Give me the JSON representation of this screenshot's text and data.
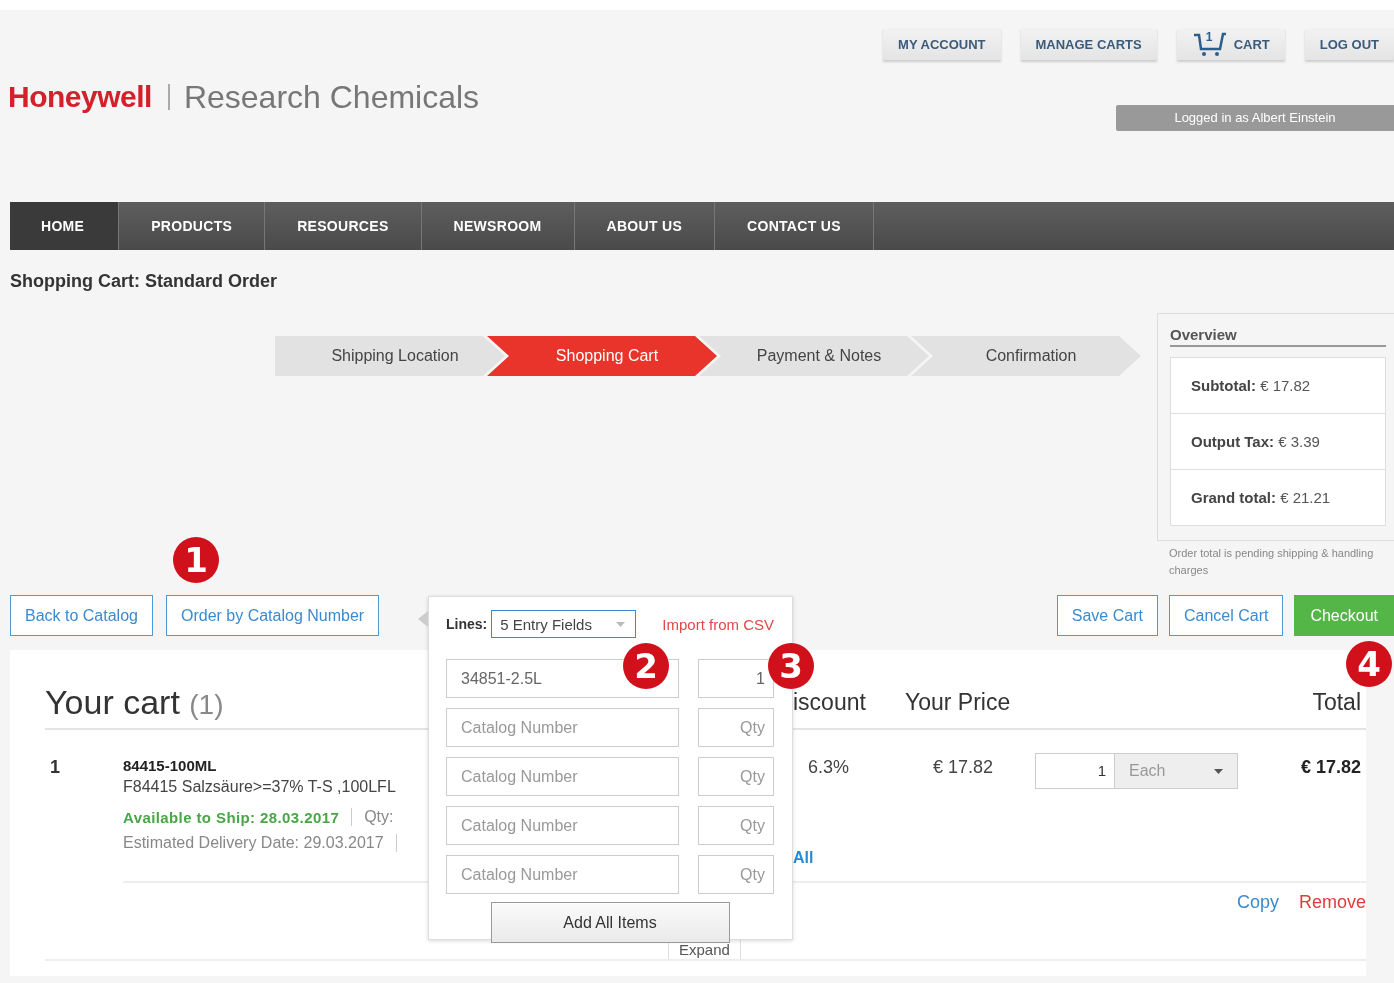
{
  "header": {
    "logo": {
      "brand": "Honeywell",
      "product": "Research Chemicals"
    },
    "top_buttons": [
      {
        "label": "MY ACCOUNT",
        "kind": "text"
      },
      {
        "label": "MANAGE CARTS",
        "kind": "text"
      },
      {
        "label": "CART",
        "kind": "cart",
        "count": "1"
      },
      {
        "label": "LOG OUT",
        "kind": "text"
      }
    ],
    "login_status": "Logged in as Albert Einstein"
  },
  "nav": [
    {
      "label": "HOME",
      "selected": true
    },
    {
      "label": "PRODUCTS",
      "selected": false
    },
    {
      "label": "RESOURCES",
      "selected": false
    },
    {
      "label": "NEWSROOM",
      "selected": false
    },
    {
      "label": "ABOUT US",
      "selected": false
    },
    {
      "label": "CONTACT US",
      "selected": false
    }
  ],
  "page_title": "Shopping Cart: Standard Order",
  "steps": [
    {
      "label": "Shipping Location",
      "selected": false
    },
    {
      "label": "Shopping Cart",
      "selected": true
    },
    {
      "label": "Payment & Notes",
      "selected": false
    },
    {
      "label": "Confirmation",
      "selected": false
    }
  ],
  "overview": {
    "title": "Overview",
    "rows": [
      {
        "label": "Subtotal:",
        "value": "€ 17.82"
      },
      {
        "label": "Output Tax:",
        "value": "€ 3.39"
      },
      {
        "label": "Grand total:",
        "value": "€ 21.21"
      }
    ],
    "note": "Order total is pending shipping & handling charges"
  },
  "actions_left": [
    {
      "label": "Back to Catalog",
      "kind": "outline"
    },
    {
      "label": "Order by Catalog Number",
      "kind": "outline"
    }
  ],
  "actions_right": [
    {
      "label": "Save Cart",
      "kind": "outline"
    },
    {
      "label": "Cancel Cart",
      "kind": "outline"
    },
    {
      "label": "Checkout",
      "kind": "primary"
    }
  ],
  "quick_order": {
    "lines_label": "Lines:",
    "lines_value": "5 Entry Fields",
    "import_link": "Import from CSV",
    "entries": [
      {
        "catalog": {
          "value": "34851-2.5L"
        },
        "qty": {
          "value": "1"
        }
      },
      {
        "catalog": {
          "placeholder": "Catalog Number"
        },
        "qty": {
          "placeholder": "Qty"
        }
      },
      {
        "catalog": {
          "placeholder": "Catalog Number"
        },
        "qty": {
          "placeholder": "Qty"
        }
      },
      {
        "catalog": {
          "placeholder": "Catalog Number"
        },
        "qty": {
          "placeholder": "Qty"
        }
      },
      {
        "catalog": {
          "placeholder": "Catalog Number"
        },
        "qty": {
          "placeholder": "Qty"
        }
      }
    ],
    "submit": "Add All Items"
  },
  "cart": {
    "title": "Your cart",
    "count": "(1)",
    "columns": [
      "iscount",
      "Your Price",
      "Total"
    ],
    "items": [
      {
        "index": "1",
        "code": "84415-100ML",
        "description": "F84415 Salzsäure>=37% T-S ,100LFL",
        "availability": "Available to Ship: 28.03.2017",
        "qty_label": "Qty:",
        "delivery": "Estimated Delivery Date: 29.03.2017",
        "discount": "6.3%",
        "link": "All",
        "price": "€ 17.82",
        "quantity": "1",
        "unit": "Each",
        "total": "€ 17.82",
        "actions": [
          {
            "label": "Copy",
            "kind": "default"
          },
          {
            "label": "Remove",
            "kind": "danger"
          }
        ],
        "expand": "Expand"
      }
    ]
  },
  "callouts": [
    "1",
    "2",
    "3",
    "4"
  ]
}
